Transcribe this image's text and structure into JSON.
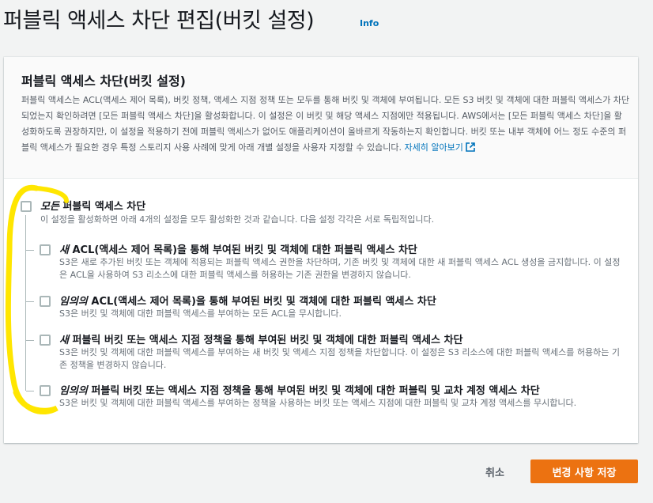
{
  "page": {
    "title": "퍼블릭 액세스 차단 편집(버킷 설정)",
    "info_link": "Info"
  },
  "panel": {
    "title": "퍼블릭 액세스 차단(버킷 설정)",
    "description": "퍼블릭 액세스는 ACL(액세스 제어 목록), 버킷 정책, 액세스 지점 정책 또는 모두를 통해 버킷 및 객체에 부여됩니다. 모든 S3 버킷 및 객체에 대한 퍼블릭 액세스가 차단되었는지 확인하려면 [모든 퍼블릭 액세스 차단]을 활성화합니다. 이 설정은 이 버킷 및 해당 액세스 지점에만 적용됩니다. AWS에서는 [모든 퍼블릭 액세스 차단]을 활성화하도록 권장하지만, 이 설정을 적용하기 전에 퍼블릭 액세스가 없어도 애플리케이션이 올바르게 작동하는지 확인합니다. 버킷 또는 내부 객체에 어느 정도 수준의 퍼블릭 액세스가 필요한 경우 특정 스토리지 사용 사례에 맞게 아래 개별 설정을 사용자 지정할 수 있습니다.",
    "learn_more": "자세히 알아보기",
    "external_icon": "external-link-icon"
  },
  "block_all": {
    "label_em": "모든",
    "label_rest": " 퍼블릭 액세스 차단",
    "description": "이 설정을 활성화하면 아래 4개의 설정을 모두 활성화한 것과 같습니다. 다음 설정 각각은 서로 독립적입니다.",
    "checked": false
  },
  "options": [
    {
      "label_em": "새",
      "label_rest": " ACL(액세스 제어 목록)을 통해 부여된 버킷 및 객체에 대한 퍼블릭 액세스 차단",
      "description": "S3은 새로 추가된 버킷 또는 객체에 적용되는 퍼블릭 액세스 권한을 차단하며, 기존 버킷 및 객체에 대한 새 퍼블릭 액세스 ACL 생성을 금지합니다. 이 설정은 ACL을 사용하여 S3 리소스에 대한 퍼블릭 액세스를 허용하는 기존 권한을 변경하지 않습니다.",
      "checked": false
    },
    {
      "label_em": "임의의",
      "label_rest": " ACL(액세스 제어 목록)을 통해 부여된 버킷 및 객체에 대한 퍼블릭 액세스 차단",
      "description": "S3은 버킷 및 객체에 대한 퍼블릭 액세스를 부여하는 모든 ACL을 무시합니다.",
      "checked": false
    },
    {
      "label_em": "새",
      "label_rest": " 퍼블릭 버킷 또는 액세스 지점 정책을 통해 부여된 버킷 및 객체에 대한 퍼블릭 액세스 차단",
      "description": "S3은 버킷 및 객체에 대한 퍼블릭 액세스를 부여하는 새 버킷 및 액세스 지점 정책을 차단합니다. 이 설정은 S3 리소스에 대한 퍼블릭 액세스를 허용하는 기존 정책을 변경하지 않습니다.",
      "checked": false
    },
    {
      "label_em": "임의의",
      "label_rest": " 퍼블릭 버킷 또는 액세스 지점 정책을 통해 부여된 버킷 및 객체에 대한 퍼블릭 및 교차 계정 액세스 차단",
      "description": "S3은 버킷 및 객체에 대한 퍼블릭 액세스를 부여하는 정책을 사용하는 버킷 또는 액세스 지점에 대한 퍼블릭 및 교차 계정 액세스를 무시합니다.",
      "checked": false
    }
  ],
  "footer": {
    "cancel_label": "취소",
    "save_label": "변경 사항 저장"
  },
  "colors": {
    "primary_button": "#ec7211",
    "link": "#0073bb",
    "annotation": "#ffe600"
  }
}
